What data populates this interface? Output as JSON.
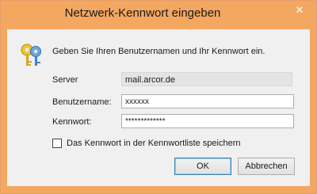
{
  "window": {
    "title": "Netzwerk-Kennwort eingeben",
    "close_glyph": "✕"
  },
  "dialog": {
    "prompt": "Geben Sie Ihren Benutzernamen und Ihr Kennwort ein.",
    "icon": "keys-icon",
    "server_label": "Server",
    "server_value": "mail.arcor.de",
    "username_label": "Benutzername:",
    "username_value": "xxxxxx",
    "password_label": "Kennwort:",
    "password_value": "*************",
    "save_checkbox_label": "Das Kennwort in der Kennwortliste speichern",
    "save_checked": false,
    "ok_label": "OK",
    "cancel_label": "Abbrechen"
  },
  "colors": {
    "titlebar": "#f4a760",
    "client": "#f0f0f0",
    "accent": "#3c7fb1"
  }
}
